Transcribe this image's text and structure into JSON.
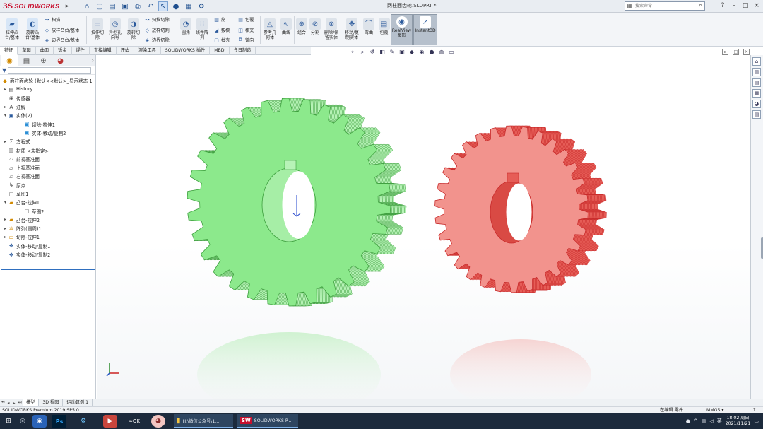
{
  "app": {
    "logo_prefix": "3S",
    "logo_name": "SOLIDWORKS",
    "doc_title": "两柱面齿轮.SLDPRT *"
  },
  "search": {
    "placeholder": "搜索命令"
  },
  "window_controls": [
    "?",
    "-",
    "□",
    "×"
  ],
  "ribbon": {
    "big_buttons": [
      {
        "label1": "拉伸凸",
        "label2": "台/基体",
        "icon": "extrude-boss-icon"
      },
      {
        "label1": "旋转凸",
        "label2": "台/基体",
        "icon": "revolve-boss-icon"
      },
      {
        "label1": "拉伸切",
        "label2": "除",
        "icon": "extrude-cut-icon"
      },
      {
        "label1": "异型孔",
        "label2": "向导",
        "icon": "hole-wizard-icon"
      },
      {
        "label1": "旋转切",
        "label2": "除",
        "icon": "revolve-cut-icon"
      },
      {
        "label1": "圆角",
        "label2": "",
        "icon": "fillet-icon"
      },
      {
        "label1": "线性阵",
        "label2": "列",
        "icon": "linear-pattern-icon"
      },
      {
        "label1": "参考几",
        "label2": "何体",
        "icon": "reference-geometry-icon"
      },
      {
        "label1": "曲线",
        "label2": "",
        "icon": "curves-icon"
      },
      {
        "label1": "组合",
        "label2": "",
        "icon": "combine-icon"
      },
      {
        "label1": "分割",
        "label2": "",
        "icon": "split-icon"
      },
      {
        "label1": "删除/保",
        "label2": "留实体",
        "icon": "delete-body-icon"
      },
      {
        "label1": "移动/复",
        "label2": "制实体",
        "icon": "move-copy-icon"
      },
      {
        "label1": "弯曲",
        "label2": "",
        "icon": "flex-icon"
      },
      {
        "label1": "包覆",
        "label2": "",
        "icon": "wrap-icon"
      },
      {
        "label1": "RealView",
        "label2": "图形",
        "icon": "realview-icon"
      },
      {
        "label1": "Instant3D",
        "label2": "",
        "icon": "instant3d-icon"
      }
    ],
    "small_buttons": [
      {
        "label": "扫描",
        "icon": "sweep-icon"
      },
      {
        "label": "放样凸台/基体",
        "icon": "loft-icon"
      },
      {
        "label": "边界凸台/基体",
        "icon": "boundary-icon"
      },
      {
        "label": "扫描切除",
        "icon": "swept-cut-icon"
      },
      {
        "label": "放样切割",
        "icon": "lofted-cut-icon"
      },
      {
        "label": "边界切除",
        "icon": "boundary-cut-icon"
      },
      {
        "label": "筋",
        "icon": "rib-icon"
      },
      {
        "label": "拔模",
        "icon": "draft-icon"
      },
      {
        "label": "抽壳",
        "icon": "shell-icon"
      },
      {
        "label": "包覆",
        "icon": "wrap-small-icon"
      },
      {
        "label": "相交",
        "icon": "intersect-icon"
      },
      {
        "label": "镜向",
        "icon": "mirror-icon"
      }
    ]
  },
  "command_tabs": [
    "特征",
    "草图",
    "曲面",
    "钣金",
    "焊件",
    "直接编辑",
    "评估",
    "渲染工具",
    "SOLIDWORKS 插件",
    "MBD",
    "今日制造"
  ],
  "feature_tree": {
    "filter_icon": "filter-icon",
    "items": [
      {
        "label": "面柱面齿轮 (默认<<默认>_显示状态 1",
        "icon": "part-icon",
        "level": 0,
        "expand": ""
      },
      {
        "label": "History",
        "icon": "history-icon",
        "level": 1,
        "expand": "▸"
      },
      {
        "label": "传感器",
        "icon": "sensor-icon",
        "level": 1,
        "expand": ""
      },
      {
        "label": "注解",
        "icon": "annotation-icon",
        "level": 1,
        "expand": "▸"
      },
      {
        "label": "实体(2)",
        "icon": "solid-bodies-icon",
        "level": 1,
        "expand": "▾"
      },
      {
        "label": "切除-拉伸1",
        "icon": "body-icon",
        "level": 2,
        "expand": ""
      },
      {
        "label": "实体-移动/复制2",
        "icon": "body-icon",
        "level": 2,
        "expand": ""
      },
      {
        "label": "方程式",
        "icon": "equation-icon",
        "level": 1,
        "expand": "▸"
      },
      {
        "label": "材质 <未指定>",
        "icon": "material-icon",
        "level": 1,
        "expand": ""
      },
      {
        "label": "前视基准面",
        "icon": "plane-icon",
        "level": 1,
        "expand": ""
      },
      {
        "label": "上视基准面",
        "icon": "plane-icon",
        "level": 1,
        "expand": ""
      },
      {
        "label": "右视基准面",
        "icon": "plane-icon",
        "level": 1,
        "expand": ""
      },
      {
        "label": "原点",
        "icon": "origin-icon",
        "level": 1,
        "expand": ""
      },
      {
        "label": "草图1",
        "icon": "sketch-icon",
        "level": 1,
        "expand": ""
      },
      {
        "label": "凸台-拉伸1",
        "icon": "boss-extrude-icon",
        "level": 1,
        "expand": "▾"
      },
      {
        "label": "草图2",
        "icon": "sketch-icon",
        "level": 2,
        "expand": ""
      },
      {
        "label": "凸台-拉伸2",
        "icon": "boss-extrude-icon",
        "level": 1,
        "expand": "▸"
      },
      {
        "label": "阵列(圆周)1",
        "icon": "circular-pattern-icon",
        "level": 1,
        "expand": "▸"
      },
      {
        "label": "切除-拉伸1",
        "icon": "cut-extrude-icon",
        "level": 1,
        "expand": "▸"
      },
      {
        "label": "实体-移动/复制1",
        "icon": "move-body-icon",
        "level": 1,
        "expand": ""
      },
      {
        "label": "实体-移动/复制2",
        "icon": "move-body-icon",
        "level": 1,
        "expand": ""
      }
    ]
  },
  "model_tabs": [
    "模型",
    "3D 视图",
    "运动算例 1"
  ],
  "status_bar": {
    "product": "SOLIDWORKS Premium 2019 SP5.0",
    "mode": "在编辑 零件",
    "units": "MMGS",
    "units_arrow": "▾",
    "help": "?"
  },
  "taskbar": {
    "apps": [
      {
        "label": "H:\\微信公众号\\1...",
        "icon": "folder-icon"
      },
      {
        "label": "SOLIDWORKS P...",
        "icon": "solidworks-icon"
      }
    ],
    "clock_time": "18:02 周日",
    "clock_date": "2021/11/21"
  },
  "colors": {
    "gear_green": "#8ce98c",
    "gear_green_dark": "#3d9e3d",
    "gear_red": "#f2938d",
    "gear_red_dark": "#c82a2a",
    "accent": "#c8102e"
  }
}
